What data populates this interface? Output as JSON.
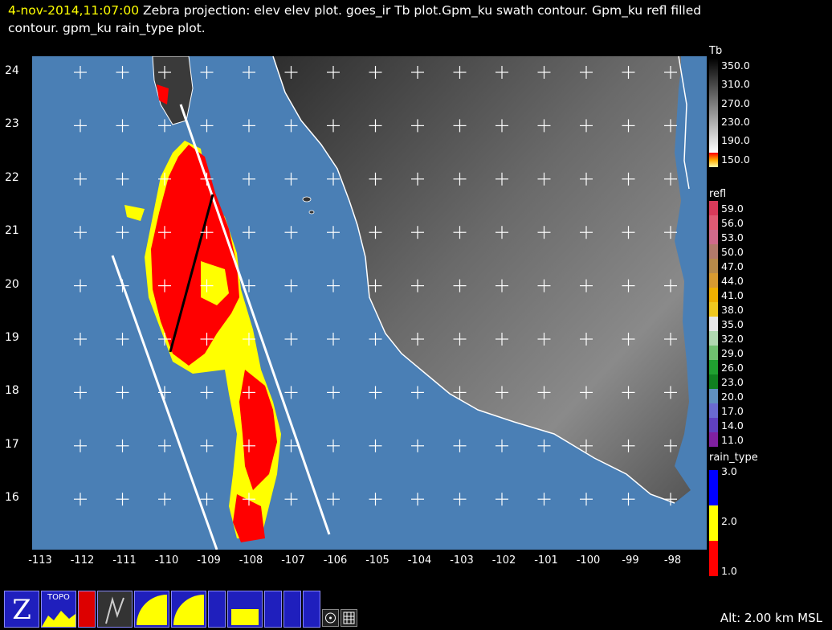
{
  "title": {
    "timestamp": "4-nov-2014,11:07:00",
    "line1_rest": "Zebra projection: elev elev  plot.  goes_ir Tb plot.Gpm_ku swath contour.  Gpm_ku refl filled",
    "line2": "contour.  gpm_ku rain_type  plot."
  },
  "axes": {
    "lat_labels": [
      "24",
      "23",
      "22",
      "21",
      "20",
      "19",
      "18",
      "17",
      "16"
    ],
    "lon_labels": [
      "-113",
      "-112",
      "-111",
      "-110",
      "-109",
      "-108",
      "-107",
      "-106",
      "-105",
      "-104",
      "-103",
      "-102",
      "-101",
      "-100",
      "-99",
      "-98"
    ]
  },
  "legends": {
    "tb": {
      "title": "Tb",
      "labels": [
        "350.0",
        "310.0",
        "270.0",
        "230.0",
        "190.0",
        "150.0"
      ]
    },
    "refl": {
      "title": "refl",
      "labels": [
        "59.0",
        "56.0",
        "53.0",
        "50.0",
        "47.0",
        "44.0",
        "41.0",
        "38.0",
        "35.0",
        "32.0",
        "29.0",
        "26.0",
        "23.0",
        "20.0",
        "17.0",
        "14.0",
        "11.0"
      ],
      "colors": [
        "#d93a5a",
        "#e05a73",
        "#d06a8a",
        "#b27a6a",
        "#b88a4a",
        "#d89a30",
        "#f0b000",
        "#f0c820",
        "#e8e8e8",
        "#b0d8b0",
        "#70c070",
        "#20a030",
        "#108020",
        "#6090c0",
        "#6a6ad0",
        "#6040c0",
        "#8020a0"
      ]
    },
    "rain_type": {
      "title": "rain_type",
      "labels": [
        "3.0",
        "2.0",
        "1.0"
      ],
      "colors": [
        "#0000ff",
        "#ffff00",
        "#ff0000"
      ]
    }
  },
  "colors": {
    "ocean": "#4a7fb5",
    "land_low": "#3a3a3a",
    "land_high": "#9a9a9a",
    "timestamp": "#ffff00"
  },
  "toolbar": {
    "buttons": [
      {
        "icon": "zebra-logo-icon",
        "label": ""
      },
      {
        "icon": "topo-icon",
        "label": "TOPO"
      },
      {
        "icon": "ir-icon",
        "label": ""
      },
      {
        "icon": "kbrr-icon",
        "label": ""
      },
      {
        "icon": "gpm-ku-icon",
        "label": ""
      },
      {
        "icon": "gpm-ku-icon",
        "label": ""
      },
      {
        "icon": "gpm-icon",
        "label": ""
      },
      {
        "icon": "sf-gpm-icon",
        "label": ""
      },
      {
        "icon": "map-icon",
        "label": ""
      },
      {
        "icon": "map-icon",
        "label": ""
      },
      {
        "icon": "sounds-icon",
        "label": ""
      },
      {
        "icon": "target-icon",
        "label": ""
      },
      {
        "icon": "grid-icon",
        "label": ""
      }
    ]
  },
  "status": {
    "altitude": "Alt: 2.00 km MSL"
  }
}
